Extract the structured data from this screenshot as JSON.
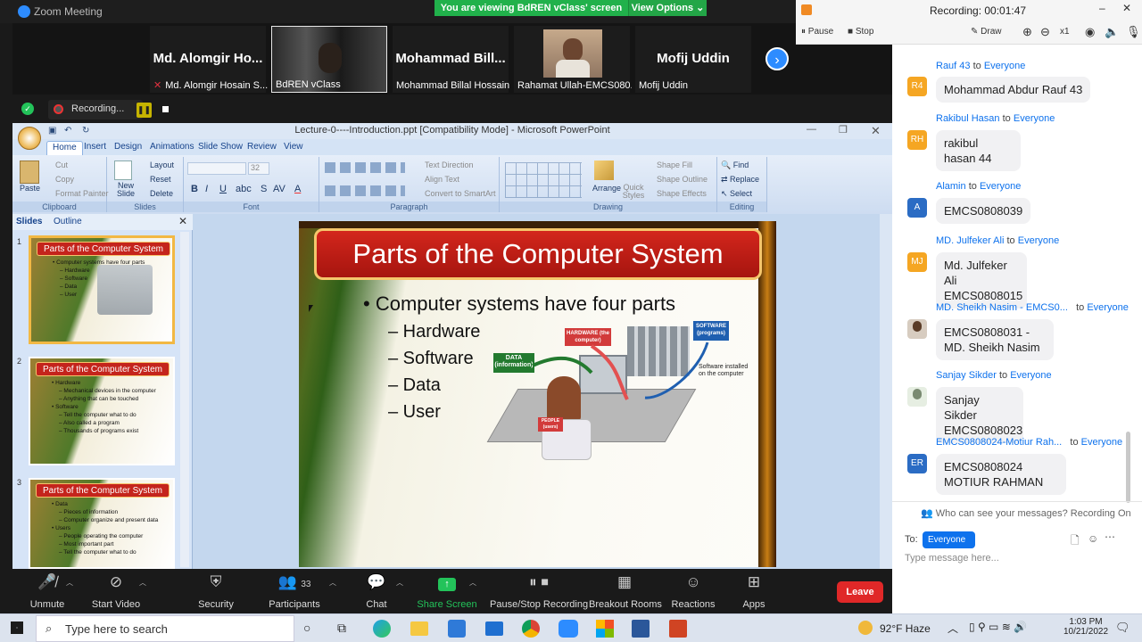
{
  "window": {
    "title": "Zoom Meeting"
  },
  "share_banner": {
    "text": "You are viewing BdREN vClass' screen",
    "view_options": "View Options"
  },
  "participants": [
    {
      "big": "Md. Alomgir Ho...",
      "label": "Md. Alomgir Hosain S...",
      "muted": true
    },
    {
      "big": "",
      "label": "BdREN vClass",
      "muted": false
    },
    {
      "big": "Mohammad Bill...",
      "label": "Mohammad Billal Hossain",
      "muted": false
    },
    {
      "big": "",
      "label": "Rahamat Ullah-EMCS080...",
      "muted": false
    },
    {
      "big": "Mofij Uddin",
      "label": "Mofij Uddin",
      "muted": false
    }
  ],
  "recording_strip": {
    "label": "Recording..."
  },
  "recording_panel": {
    "status": "Recording:",
    "time": "00:01:47",
    "pause": "Pause",
    "stop": "Stop",
    "draw": "Draw",
    "zoom": "x1"
  },
  "ppt": {
    "title": "Lecture-0----Introduction.ppt [Compatibility Mode] - Microsoft PowerPoint",
    "tabs": [
      "Home",
      "Insert",
      "Design",
      "Animations",
      "Slide Show",
      "Review",
      "View"
    ],
    "ribbon": {
      "groups": [
        "Clipboard",
        "Slides",
        "Font",
        "Paragraph",
        "Drawing",
        "Editing"
      ],
      "clipboard": {
        "paste": "Paste",
        "cut": "Cut",
        "copy": "Copy",
        "format_painter": "Format Painter"
      },
      "slides": {
        "new_slide": "New Slide",
        "layout": "Layout",
        "reset": "Reset",
        "delete": "Delete"
      },
      "font": {
        "size": "32"
      },
      "paragraph": {
        "text_direction": "Text Direction",
        "align_text": "Align Text",
        "convert": "Convert to SmartArt"
      },
      "drawing": {
        "arrange": "Arrange",
        "quick_styles": "Quick Styles",
        "shape_fill": "Shape Fill",
        "shape_outline": "Shape Outline",
        "shape_effects": "Shape Effects"
      },
      "editing": {
        "find": "Find",
        "replace": "Replace",
        "select": "Select"
      }
    },
    "pane_tabs": [
      "Slides",
      "Outline"
    ],
    "thumbnails": [
      {
        "num": "1",
        "title": "Parts of the Computer System",
        "lines": [
          "• Computer systems have four parts",
          "– Hardware",
          "– Software",
          "– Data",
          "– User"
        ]
      },
      {
        "num": "2",
        "title": "Parts of the Computer System",
        "lines": [
          "• Hardware",
          "– Mechanical devices in the computer",
          "– Anything that can be touched",
          "• Software",
          "– Tell the computer what to do",
          "– Also called a program",
          "– Thousands of programs exist"
        ]
      },
      {
        "num": "3",
        "title": "Parts of the Computer System",
        "lines": [
          "• Data",
          "– Pieces of information",
          "– Computer organize and present data",
          "• Users",
          "– People operating the computer",
          "– Most important part",
          "– Tell the computer what to do"
        ]
      }
    ],
    "slide": {
      "title": "Parts of the Computer System",
      "bullet": "• Computer systems have four parts",
      "subs": [
        "– Hardware",
        "– Software",
        "– Data",
        "– User"
      ],
      "illustration": {
        "hardware": "HARDWARE (the computer)",
        "software": "SOFTWARE (programs)",
        "data": "DATA (information)",
        "people": "PEOPLE (users)",
        "installed": "Software installed on the computer"
      }
    }
  },
  "chat": {
    "messages": [
      {
        "initials": "R4",
        "color": "#f5a623",
        "sender": "Rauf 43",
        "to": "Everyone",
        "text": "Mohammad Abdur Rauf 43"
      },
      {
        "initials": "RH",
        "color": "#f5a623",
        "sender": "Rakibul Hasan",
        "to": "Everyone",
        "text": "rakibul hasan 44"
      },
      {
        "initials": "A",
        "color": "#2b6cc4",
        "sender": "Alamin",
        "to": "Everyone",
        "text": "EMCS0808039"
      },
      {
        "initials": "MJ",
        "color": "#f5a623",
        "sender": "MD. Julfeker Ali",
        "to": "Everyone",
        "text": "Md. Julfeker Ali EMCS0808015"
      },
      {
        "initials": "",
        "color": "#7a5a3a",
        "sender": "MD. Sheikh Nasim - EMCS0...",
        "to": "Everyone",
        "text": "EMCS0808031 - MD. Sheikh Nasim"
      },
      {
        "initials": "",
        "color": "#9fb59a",
        "sender": "Sanjay Sikder",
        "to": "Everyone",
        "text": "Sanjay Sikder EMCS0808023"
      },
      {
        "initials": "ER",
        "color": "#2b6cc4",
        "sender": "EMCS0808024-Motiur Rah...",
        "to": "Everyone",
        "text": "EMCS0808024 MOTIUR RAHMAN"
      }
    ],
    "privacy_note": "Who can see your messages? Recording On",
    "to_label": "To:",
    "to_value": "Everyone",
    "placeholder": "Type message here..."
  },
  "toolbar": {
    "unmute": "Unmute",
    "start_video": "Start Video",
    "security": "Security",
    "participants": "Participants",
    "participant_count": "33",
    "chat": "Chat",
    "share_screen": "Share Screen",
    "pause_stop": "Pause/Stop Recording",
    "breakout": "Breakout Rooms",
    "reactions": "Reactions",
    "apps": "Apps",
    "leave": "Leave"
  },
  "taskbar": {
    "search": "Type here to search",
    "weather": "92°F Haze",
    "time": "1:03 PM",
    "date": "10/21/2022"
  }
}
